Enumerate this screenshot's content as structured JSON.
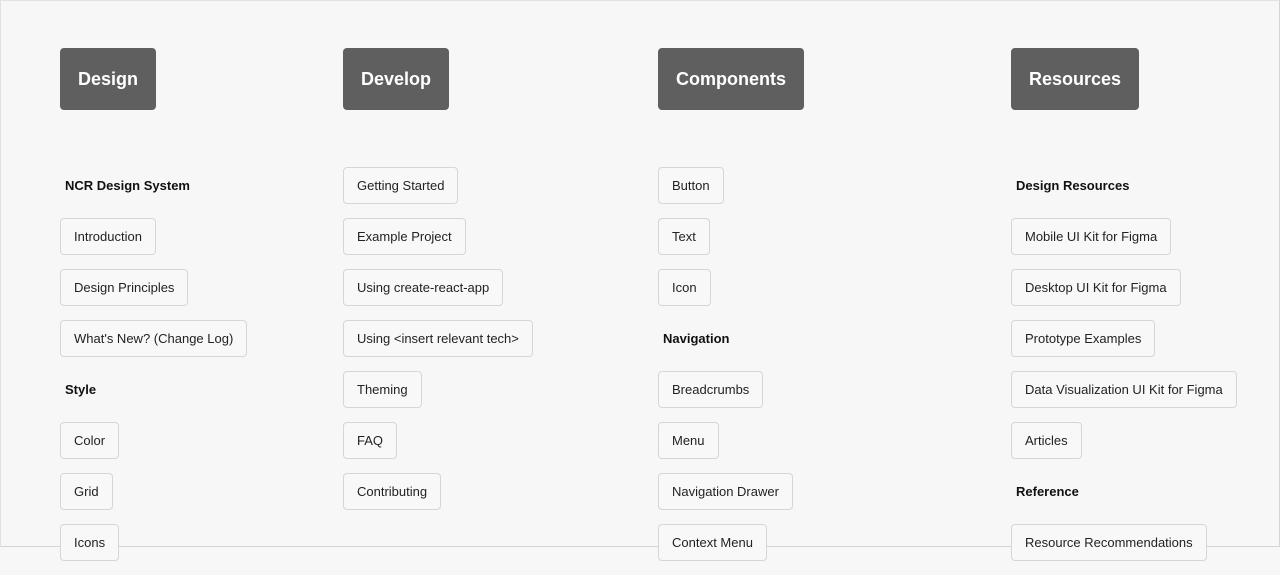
{
  "columns": [
    {
      "title": "Design",
      "rows": [
        {
          "type": "section",
          "label": "NCR Design System"
        },
        {
          "type": "link",
          "label": "Introduction"
        },
        {
          "type": "link",
          "label": "Design Principles"
        },
        {
          "type": "link",
          "label": "What's New? (Change Log)"
        },
        {
          "type": "section",
          "label": "Style"
        },
        {
          "type": "link",
          "label": "Color"
        },
        {
          "type": "link",
          "label": "Grid"
        },
        {
          "type": "link",
          "label": "Icons"
        }
      ]
    },
    {
      "title": "Develop",
      "rows": [
        {
          "type": "link",
          "label": "Getting Started"
        },
        {
          "type": "link",
          "label": "Example Project"
        },
        {
          "type": "link",
          "label": "Using create-react-app"
        },
        {
          "type": "link",
          "label": "Using <insert relevant tech>"
        },
        {
          "type": "link",
          "label": "Theming"
        },
        {
          "type": "link",
          "label": "FAQ"
        },
        {
          "type": "link",
          "label": "Contributing"
        }
      ]
    },
    {
      "title": "Components",
      "rows": [
        {
          "type": "link",
          "label": "Button"
        },
        {
          "type": "link",
          "label": "Text"
        },
        {
          "type": "link",
          "label": "Icon"
        },
        {
          "type": "section",
          "label": "Navigation"
        },
        {
          "type": "link",
          "label": "Breadcrumbs"
        },
        {
          "type": "link",
          "label": "Menu"
        },
        {
          "type": "link",
          "label": "Navigation Drawer"
        },
        {
          "type": "link",
          "label": "Context Menu"
        }
      ]
    },
    {
      "title": "Resources",
      "rows": [
        {
          "type": "section",
          "label": "Design Resources"
        },
        {
          "type": "link",
          "label": "Mobile UI Kit for Figma"
        },
        {
          "type": "link",
          "label": "Desktop UI Kit for Figma"
        },
        {
          "type": "link",
          "label": "Prototype Examples"
        },
        {
          "type": "link",
          "label": "Data Visualization UI Kit for Figma"
        },
        {
          "type": "link",
          "label": "Articles"
        },
        {
          "type": "section",
          "label": "Reference"
        },
        {
          "type": "link",
          "label": "Resource Recommendations"
        }
      ]
    }
  ]
}
